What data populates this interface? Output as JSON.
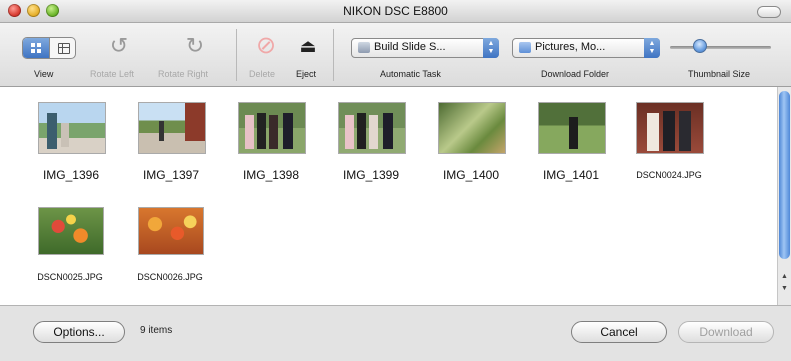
{
  "window": {
    "title": "NIKON DSC E8800"
  },
  "toolbar": {
    "view_label": "View",
    "rotate_left_label": "Rotate Left",
    "rotate_right_label": "Rotate Right",
    "delete_label": "Delete",
    "eject_label": "Eject",
    "automatic_task": {
      "value": "Build Slide S...",
      "label": "Automatic Task"
    },
    "download_folder": {
      "value": "Pictures, Mo...",
      "label": "Download Folder"
    },
    "thumbnail_size": {
      "label": "Thumbnail Size",
      "level": 0.27
    }
  },
  "thumbnails": [
    {
      "name": "IMG_1396"
    },
    {
      "name": "IMG_1397"
    },
    {
      "name": "IMG_1398"
    },
    {
      "name": "IMG_1399"
    },
    {
      "name": "IMG_1400"
    },
    {
      "name": "IMG_1401"
    },
    {
      "name": "DSCN0024.JPG"
    },
    {
      "name": "DSCN0025.JPG"
    },
    {
      "name": "DSCN0026.JPG"
    }
  ],
  "footer": {
    "options_label": "Options...",
    "items_count": "9 items",
    "cancel_label": "Cancel",
    "download_label": "Download"
  },
  "colors": {
    "accent": "#3f74c3",
    "disabled_text": "#a8a8a8"
  }
}
